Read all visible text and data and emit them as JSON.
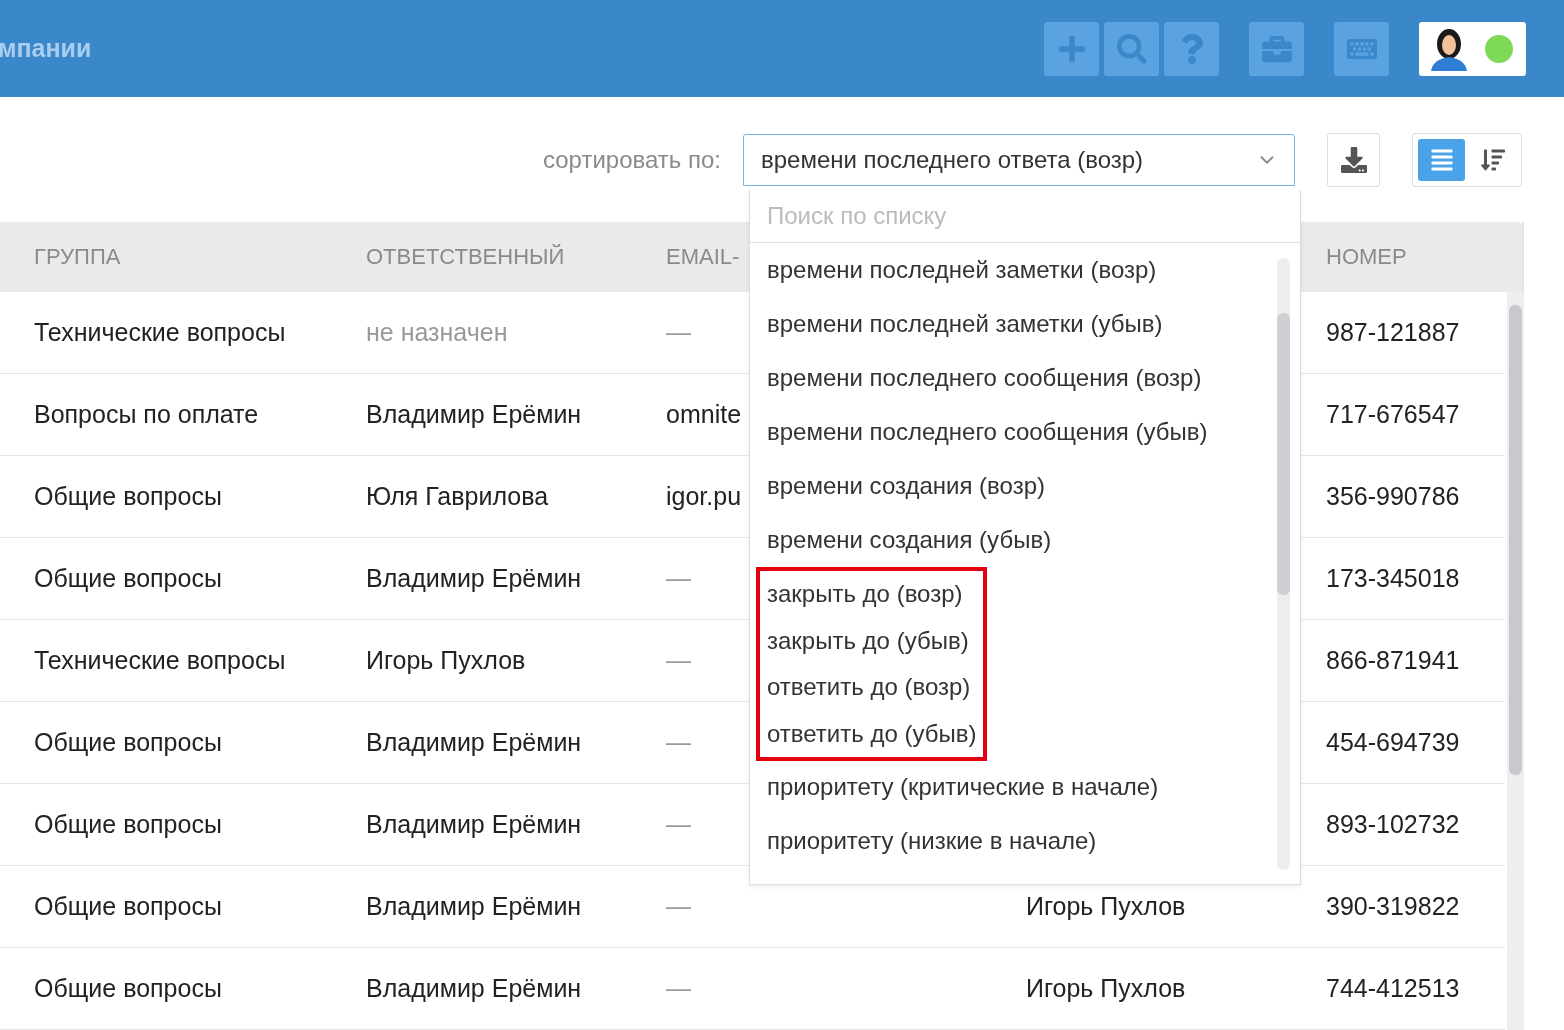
{
  "header": {
    "title": "мпании",
    "user": {
      "online": true
    }
  },
  "toolbar": {
    "sort_label": "сортировать по:",
    "sort_value": "времени последнего ответа (возр)",
    "views": [
      {
        "selected": true
      },
      {
        "selected": false
      }
    ]
  },
  "dropdown": {
    "search_placeholder": "Поиск по списку",
    "items": [
      {
        "label": "времени последней заметки (возр)",
        "highlighted": false
      },
      {
        "label": "времени последней заметки (убыв)",
        "highlighted": false
      },
      {
        "label": "времени последнего сообщения (возр)",
        "highlighted": false
      },
      {
        "label": "времени последнего сообщения (убыв)",
        "highlighted": false
      },
      {
        "label": "времени создания (возр)",
        "highlighted": false
      },
      {
        "label": "времени создания (убыв)",
        "highlighted": false
      },
      {
        "label": "закрыть до (возр)",
        "highlighted": true
      },
      {
        "label": "закрыть до (убыв)",
        "highlighted": true
      },
      {
        "label": "ответить до (возр)",
        "highlighted": true
      },
      {
        "label": "ответить до (убыв)",
        "highlighted": true
      },
      {
        "label": "приоритету (критические в начале)",
        "highlighted": false
      },
      {
        "label": "приоритету (низкие в начале)",
        "highlighted": false
      }
    ]
  },
  "table": {
    "columns": [
      "ГРУППА",
      "ОТВЕТСТВЕННЫЙ",
      "EMAIL-",
      "НОМЕР"
    ],
    "rows": [
      {
        "group": "Технические вопросы",
        "assignee": "не назначен",
        "unassigned": true,
        "email": "—",
        "number": "987-121887"
      },
      {
        "group": "Вопросы по оплате",
        "assignee": "Владимир Ерёмин",
        "unassigned": false,
        "email": "omnite",
        "number": "717-676547"
      },
      {
        "group": "Общие вопросы",
        "assignee": "Юля Гаврилова",
        "unassigned": false,
        "email": "igor.pu",
        "number": "356-990786"
      },
      {
        "group": "Общие вопросы",
        "assignee": "Владимир Ерёмин",
        "unassigned": false,
        "email": "—",
        "number": "173-345018"
      },
      {
        "group": "Технические вопросы",
        "assignee": "Игорь Пухлов",
        "unassigned": false,
        "email": "—",
        "number": "866-871941"
      },
      {
        "group": "Общие вопросы",
        "assignee": "Владимир Ерёмин",
        "unassigned": false,
        "email": "—",
        "number": "454-694739"
      },
      {
        "group": "Общие вопросы",
        "assignee": "Владимир Ерёмин",
        "unassigned": false,
        "email": "—",
        "number": "893-102732"
      },
      {
        "group": "Общие вопросы",
        "assignee": "Владимир Ерёмин",
        "unassigned": false,
        "email": "—",
        "column_4": "Игорь Пухлов",
        "number": "390-319822"
      },
      {
        "group": "Общие вопросы",
        "assignee": "Владимир Ерёмин",
        "unassigned": false,
        "email": "—",
        "column_4": "Игорь Пухлов",
        "number": "744-412513"
      }
    ]
  }
}
